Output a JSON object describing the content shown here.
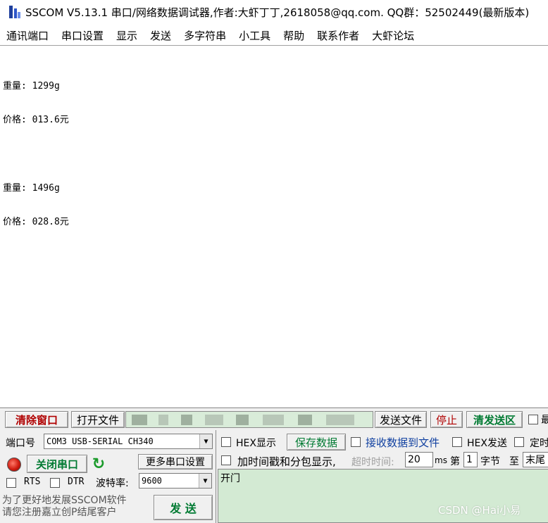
{
  "window": {
    "title": "SSCOM V5.13.1 串口/网络数据调试器,作者:大虾丁丁,2618058@qq.com. QQ群：52502449(最新版本)"
  },
  "menu": {
    "items": [
      "通讯端口",
      "串口设置",
      "显示",
      "发送",
      "多字符串",
      "小工具",
      "帮助",
      "联系作者",
      "大虾论坛"
    ]
  },
  "receive": {
    "lines": [
      "重量: 1299g",
      "价格: 013.6元",
      "",
      "重量: 1496g",
      "价格: 028.8元"
    ]
  },
  "toolbar": {
    "clear_window": "清除窗口",
    "open_file": "打开文件",
    "send_file": "发送文件",
    "stop": "停止",
    "clear_send": "清发送区",
    "cut_off": "最"
  },
  "port": {
    "label": "端口号",
    "value": "COM3 USB-SERIAL CH340",
    "close_button": "关闭串口",
    "more_settings": "更多串口设置",
    "rts": "RTS",
    "dtr": "DTR",
    "baud_label": "波特率:",
    "baud_value": "9600"
  },
  "promo": {
    "line1": "为了更好地发展SSCOM软件",
    "line2": "请您注册嘉立创P结尾客户"
  },
  "send_button": "发 送",
  "options": {
    "hex_display": "HEX显示",
    "save_data": "保存数据",
    "receive_to_file": "接收数据到文件",
    "hex_send": "HEX发送",
    "timed_send": "定时",
    "add_timestamp": "加时间戳和分包显示,",
    "timeout_label": "超时时间:",
    "timeout_value": "20",
    "ms": "ms",
    "di": "第",
    "byte_index": "1",
    "byte_label": "字节",
    "to": "至",
    "end": "末尾"
  },
  "send_area": {
    "text": "开门"
  },
  "watermark": "CSDN @Hai小易"
}
